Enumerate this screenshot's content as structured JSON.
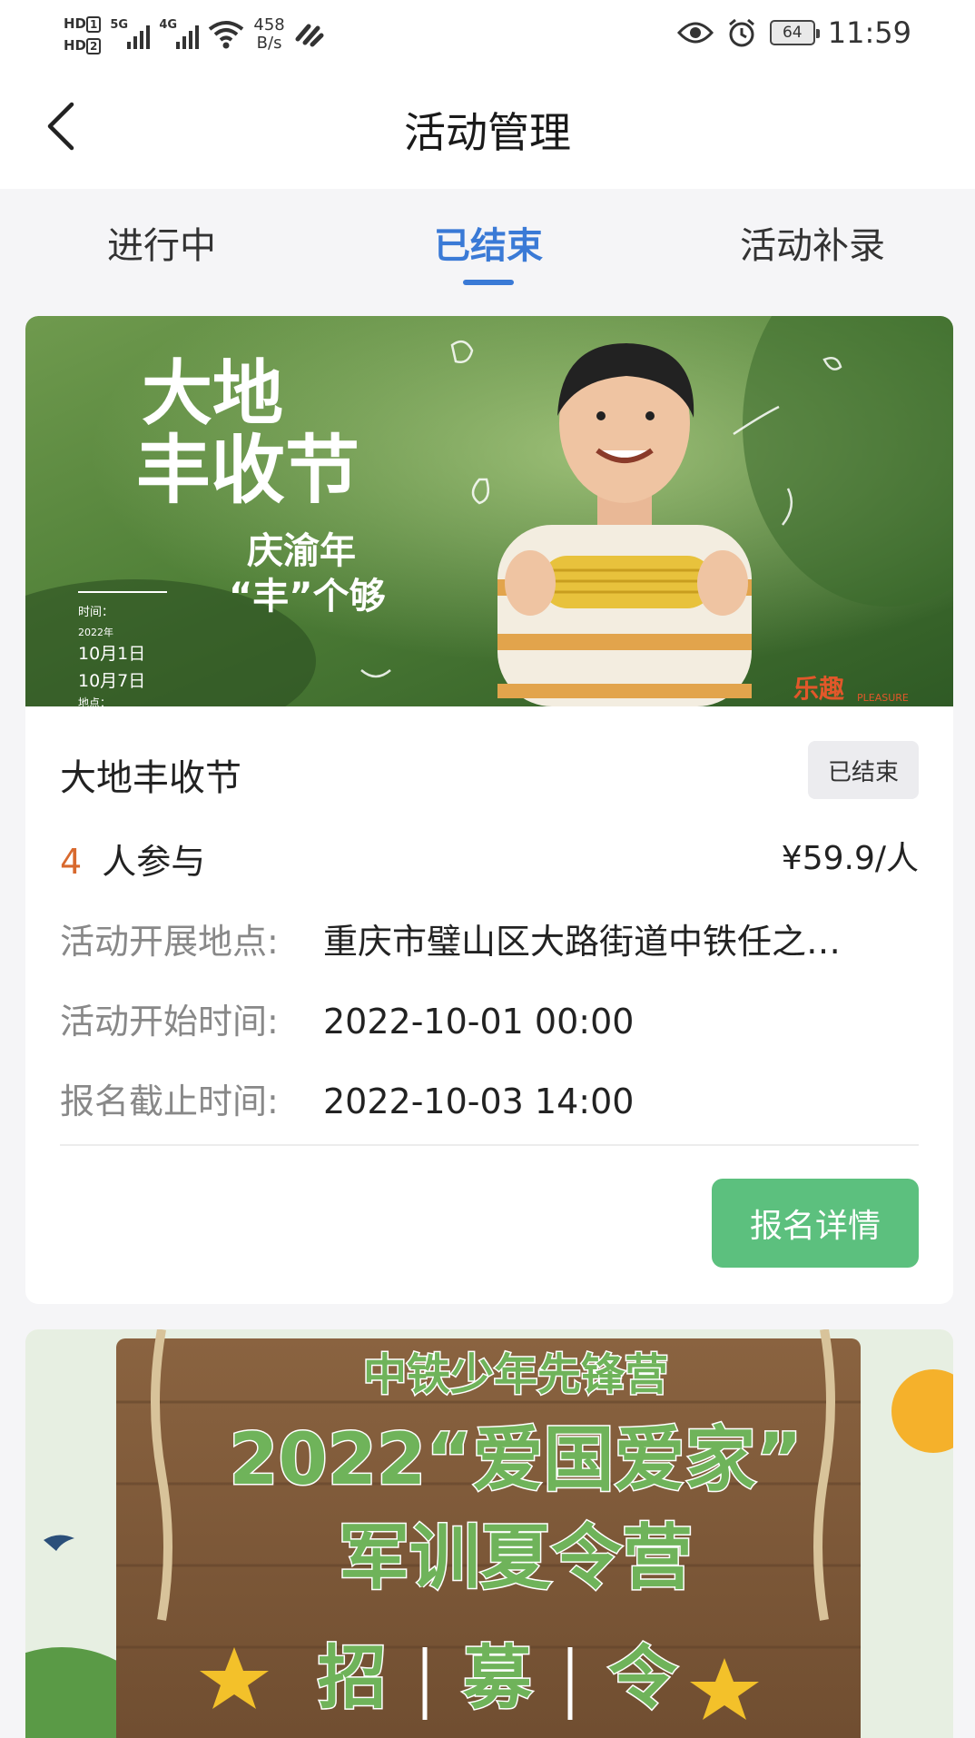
{
  "status_bar": {
    "hd1": "HD",
    "hd1_sub": "1",
    "hd2": "HD",
    "hd2_sub": "2",
    "net1": "5G",
    "net2": "4G",
    "speed_value": "458",
    "speed_unit": "B/s",
    "battery": "64",
    "time": "11:59"
  },
  "header": {
    "title": "活动管理"
  },
  "tabs": [
    {
      "label": "进行中",
      "active": false
    },
    {
      "label": "已结束",
      "active": true
    },
    {
      "label": "活动补录",
      "active": false
    }
  ],
  "activities": [
    {
      "banner": {
        "title_line1": "大地",
        "title_line2": "丰收节",
        "slogan_line1": "庆渝年",
        "slogan_line2": "“丰”个够",
        "time_label": "时间：",
        "year": "2022年",
        "date1": "10月1日",
        "date2": "10月7日",
        "place_label": "地点：",
        "brand": "乐趣",
        "brand_en": "PLEASURE"
      },
      "title": "大地丰收节",
      "status": "已结束",
      "participant_count": "4",
      "participant_label": "人参与",
      "price": "¥59.9/人",
      "location_label": "活动开展地点:",
      "location": "重庆市璧山区大路街道中铁任之…",
      "start_label": "活动开始时间:",
      "start_time": "2022-10-01 00:00",
      "deadline_label": "报名截止时间:",
      "deadline": "2022-10-03 14:00",
      "button_label": "报名详情"
    },
    {
      "banner": {
        "line1": "中铁少年先锋营",
        "line2": "2022“爱国爱家”",
        "line3": "军训夏令营",
        "line4_a": "招",
        "line4_b": "募",
        "line4_c": "令"
      }
    }
  ]
}
